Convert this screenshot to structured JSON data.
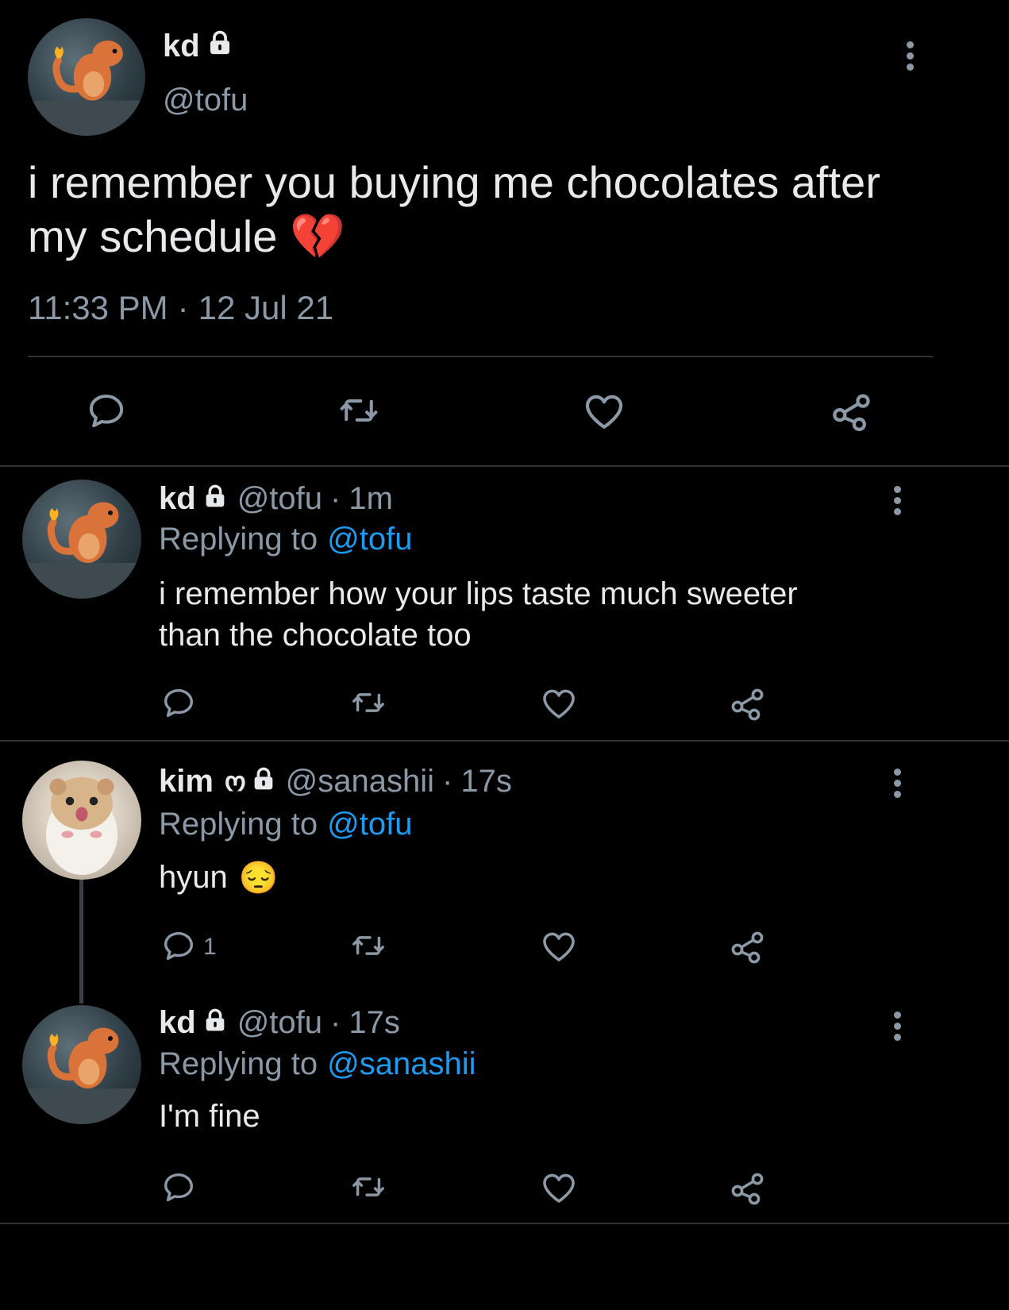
{
  "main_tweet": {
    "display_name": "kd",
    "handle": "@tofu",
    "text_line1": "i remember you buying me chocolates after",
    "text_line2": "my schedule",
    "emoji": "💔",
    "time": "11:33 PM",
    "dot": "·",
    "date": "12 Jul 21"
  },
  "replies": [
    {
      "display_name": "kd",
      "handle": "@tofu",
      "time": "1m",
      "replying_label": "Replying to",
      "replying_to": "@tofu",
      "text_line1": "i remember how your lips taste much sweeter",
      "text_line2": "than the chocolate too"
    },
    {
      "display_name": "kim",
      "name_emoji": "ო",
      "handle": "@sanashii",
      "time": "17s",
      "replying_label": "Replying to",
      "replying_to": "@tofu",
      "text_line1": "hyun",
      "emoji": "😔",
      "reply_count": "1"
    },
    {
      "display_name": "kd",
      "handle": "@tofu",
      "time": "17s",
      "replying_label": "Replying to",
      "replying_to": "@sanashii",
      "text_line1": "I'm fine"
    }
  ],
  "separator": "·",
  "icons": {
    "reply": "reply-bubble-icon",
    "retweet": "retweet-icon",
    "like": "heart-icon",
    "share": "share-icon",
    "more": "more-vertical-icon",
    "lock": "lock-icon"
  },
  "colors": {
    "background": "#000000",
    "text": "#e7e9ea",
    "secondary": "#8b98a5",
    "link": "#1d9bf0",
    "divider": "#2f3336"
  }
}
